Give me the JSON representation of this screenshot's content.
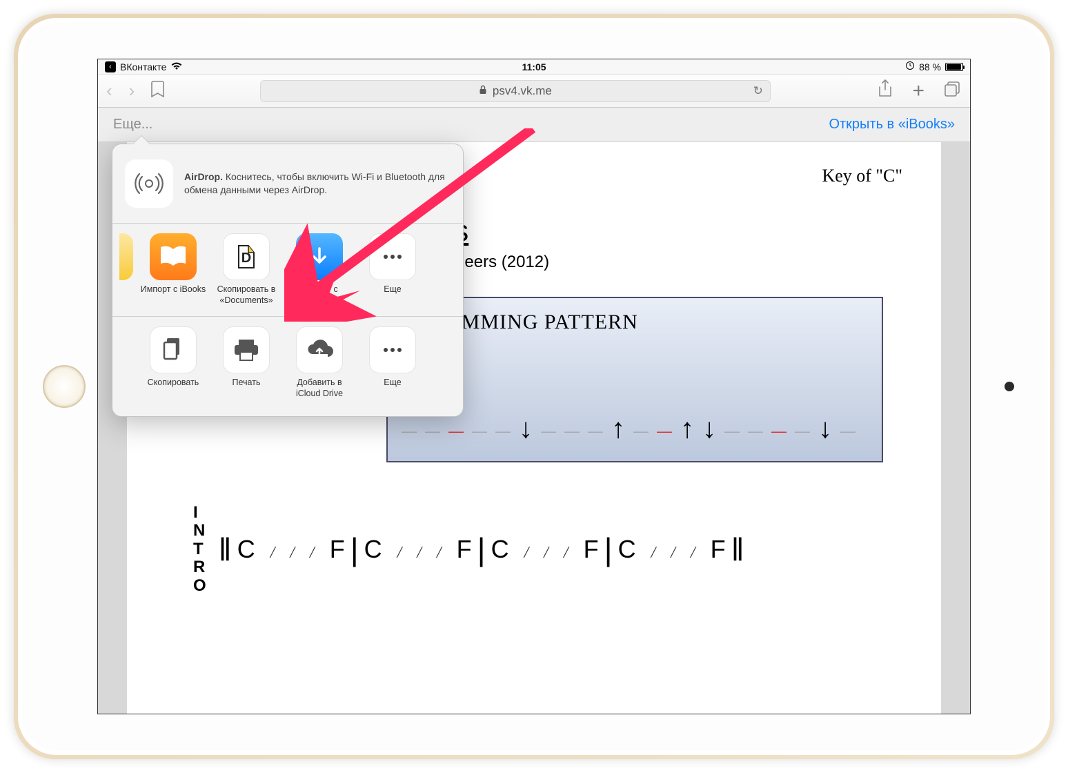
{
  "status_bar": {
    "app_name": "ВКонтакте",
    "time": "11:05",
    "battery_pct": "88 %"
  },
  "toolbar": {
    "url_domain": "psv4.vk.me"
  },
  "subbar": {
    "more": "Еще...",
    "open_in": "Открыть в «iBooks»"
  },
  "share_sheet": {
    "airdrop_title": "AirDrop.",
    "airdrop_text": " Коснитесь, чтобы включить Wi-Fi и Bluetooth для обмена данными через AirDrop.",
    "row1": {
      "ibooks": "Импорт с iBooks",
      "documents": "Скопировать в «Documents»",
      "downloads": "Импорт с Downloads",
      "more": "Еще"
    },
    "row2": {
      "copy": "Скопировать",
      "print": "Печать",
      "icloud": "Добавить в iCloud Drive",
      "more": "Еще"
    }
  },
  "document": {
    "key": "Key of \"C\"",
    "title_fragment": "\" by The Lumineers",
    "subtitle": "The Lumineers (2012)",
    "strumming_heading": "STRUMMING PATTERN",
    "intro_label": "INTRO",
    "intro_chords": [
      "C",
      "F",
      "C",
      "F",
      "C",
      "F",
      "C",
      "F"
    ]
  }
}
